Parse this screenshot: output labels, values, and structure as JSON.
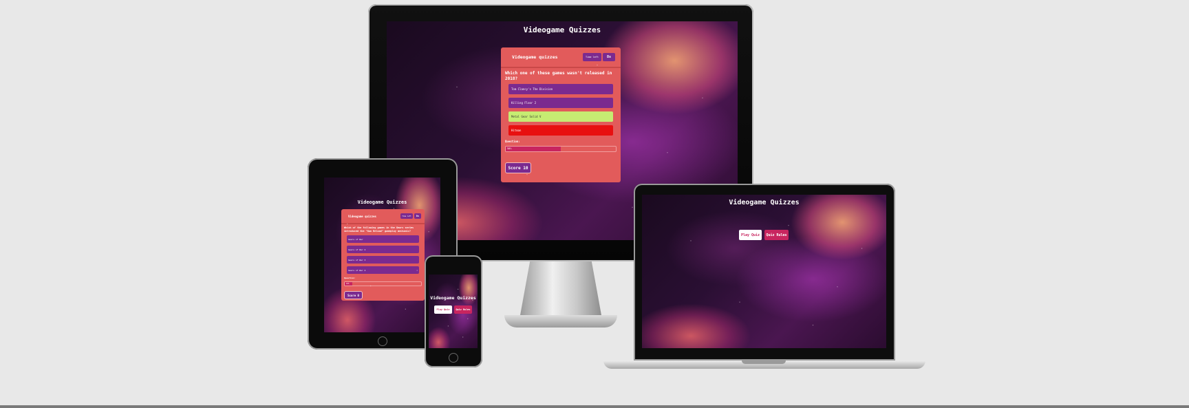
{
  "site_title": "Videogame Quizzes",
  "monitor": {
    "card_title": "Videogame quizzes",
    "timer_label": "Time left",
    "timer_value": "8s",
    "question": "Which one of these games wasn't released in 2018?",
    "answers": [
      {
        "label": "Tom Clancy's The Division",
        "state": "default"
      },
      {
        "label": "Killing Floor 2",
        "state": "default"
      },
      {
        "label": "Metal Gear Solid V",
        "state": "correct"
      },
      {
        "label": "Hitman",
        "state": "wrong"
      }
    ],
    "question_counter_label": "Question:",
    "progress_text": "50%",
    "progress_fraction": 0.5,
    "score_label": "Score 10"
  },
  "tablet": {
    "card_title": "Videogame quizzes",
    "timer_label": "Time left",
    "timer_value": "8s",
    "question": "Which of the following games in the Gears series introduced the \"Gun Reload\" gameplay mechanic?",
    "answers": [
      {
        "label": "Gears of War"
      },
      {
        "label": "Gears of War 2"
      },
      {
        "label": "Gears of War 3"
      },
      {
        "label": "Gears of War 4"
      }
    ],
    "question_counter_label": "Question:",
    "progress_text": "10%",
    "progress_fraction": 0.1,
    "score_label": "Score 0"
  },
  "menu": {
    "play_label": "Play Quiz",
    "rules_label": "Quiz Rules"
  },
  "colors": {
    "card": "#e25b5b",
    "accent_purple": "#7b2a8f",
    "accent_pink": "#c8255f",
    "correct": "#c6ec72",
    "wrong": "#e81010"
  }
}
